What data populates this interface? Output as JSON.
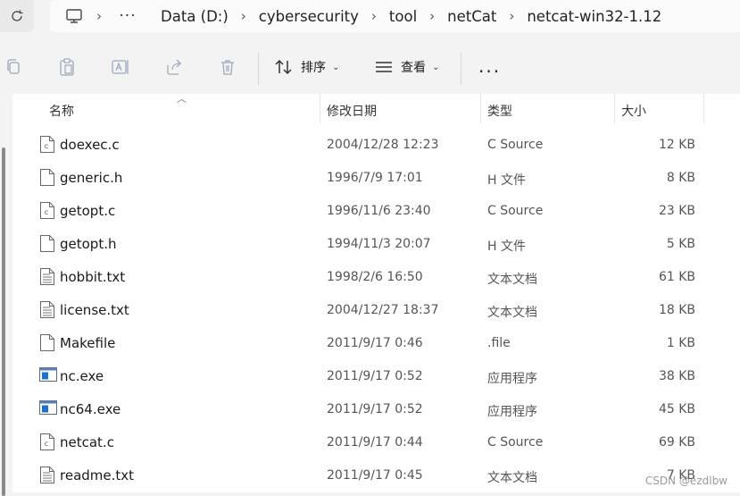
{
  "address_bar": {
    "breadcrumbs": [
      "Data (D:)",
      "cybersecurity",
      "tool",
      "netCat",
      "netcat-win32-1.12"
    ],
    "overflow": "···"
  },
  "toolbar": {
    "sort_label": "排序",
    "view_label": "查看",
    "more_label": "···"
  },
  "columns": {
    "name": "名称",
    "date": "修改日期",
    "type": "类型",
    "size": "大小"
  },
  "files": [
    {
      "name": "doexec.c",
      "date": "2004/12/28 12:23",
      "type": "C Source",
      "size": "12 KB",
      "icon": "c-source-file-icon"
    },
    {
      "name": "generic.h",
      "date": "1996/7/9 17:01",
      "type": "H 文件",
      "size": "8 KB",
      "icon": "blank-file-icon"
    },
    {
      "name": "getopt.c",
      "date": "1996/11/6 23:40",
      "type": "C Source",
      "size": "23 KB",
      "icon": "c-source-file-icon"
    },
    {
      "name": "getopt.h",
      "date": "1994/11/3 20:07",
      "type": "H 文件",
      "size": "5 KB",
      "icon": "blank-file-icon"
    },
    {
      "name": "hobbit.txt",
      "date": "1998/2/6 16:50",
      "type": "文本文档",
      "size": "61 KB",
      "icon": "text-file-icon"
    },
    {
      "name": "license.txt",
      "date": "2004/12/27 18:37",
      "type": "文本文档",
      "size": "18 KB",
      "icon": "text-file-icon"
    },
    {
      "name": "Makefile",
      "date": "2011/9/17 0:46",
      "type": ".file",
      "size": "1 KB",
      "icon": "blank-file-icon"
    },
    {
      "name": "nc.exe",
      "date": "2011/9/17 0:52",
      "type": "应用程序",
      "size": "38 KB",
      "icon": "exe-file-icon"
    },
    {
      "name": "nc64.exe",
      "date": "2011/9/17 0:52",
      "type": "应用程序",
      "size": "45 KB",
      "icon": "exe-file-icon"
    },
    {
      "name": "netcat.c",
      "date": "2011/9/17 0:44",
      "type": "C Source",
      "size": "69 KB",
      "icon": "c-source-file-icon"
    },
    {
      "name": "readme.txt",
      "date": "2011/9/17 0:45",
      "type": "文本文档",
      "size": "7 KB",
      "icon": "text-file-icon"
    }
  ],
  "watermark": "CSDN @ezdlbw"
}
